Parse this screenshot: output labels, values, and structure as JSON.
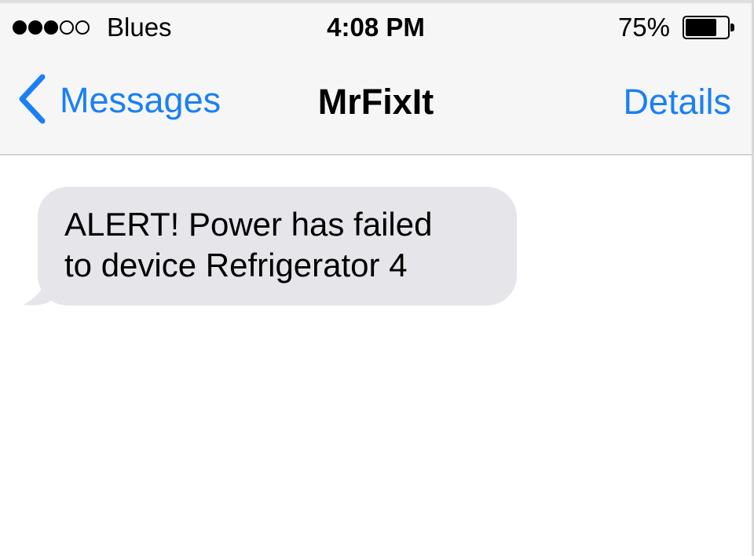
{
  "status_bar": {
    "signal_filled": 3,
    "signal_total": 5,
    "carrier": "Blues",
    "time": "4:08 PM",
    "battery_percent_text": "75%",
    "battery_level": 0.75
  },
  "nav": {
    "back_label": "Messages",
    "title": "MrFixIt",
    "details_label": "Details",
    "accent_color": "#1a80f4"
  },
  "messages": [
    {
      "direction": "incoming",
      "text": "ALERT! Power has failed\nto device Refrigerator 4",
      "bubble_color": "#e5e5ea"
    }
  ],
  "icons": {
    "back": "chevron-left-icon",
    "battery": "battery-icon",
    "signal": "signal-strength-icon"
  }
}
